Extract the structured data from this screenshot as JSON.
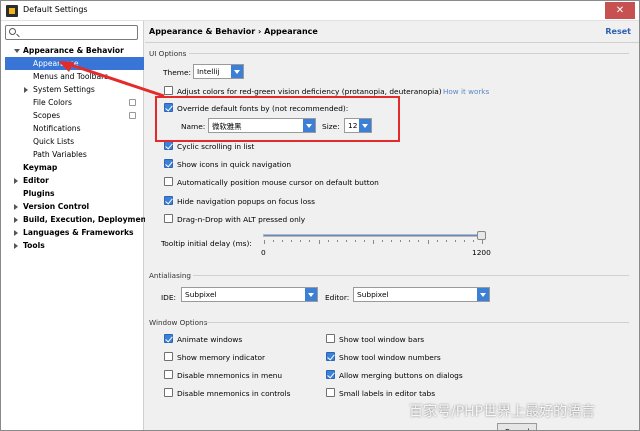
{
  "window": {
    "title": "Default Settings",
    "close_glyph": "✕"
  },
  "sidebar": {
    "search": {
      "placeholder": "",
      "value": ""
    },
    "items": [
      {
        "label": "Appearance & Behavior",
        "icon": "chevron-down-icon"
      },
      {
        "label": "Appearance"
      },
      {
        "label": "Menus and Toolbars"
      },
      {
        "label": "System Settings",
        "icon": "chevron-right-icon"
      },
      {
        "label": "File Colors"
      },
      {
        "label": "Scopes"
      },
      {
        "label": "Notifications"
      },
      {
        "label": "Quick Lists"
      },
      {
        "label": "Path Variables"
      },
      {
        "label": "Keymap"
      },
      {
        "label": "Editor",
        "icon": "chevron-right-icon"
      },
      {
        "label": "Plugins"
      },
      {
        "label": "Version Control",
        "icon": "chevron-right-icon"
      },
      {
        "label": "Build, Execution, Deployment",
        "icon": "chevron-right-icon"
      },
      {
        "label": "Languages & Frameworks",
        "icon": "chevron-right-icon"
      },
      {
        "label": "Tools",
        "icon": "chevron-right-icon"
      }
    ]
  },
  "header": {
    "breadcrumb_parent": "Appearance & Behavior",
    "separator": "›",
    "breadcrumb_current": "Appearance",
    "reset": "Reset"
  },
  "ui_options": {
    "section_title": "UI Options",
    "theme_label": "Theme:",
    "theme_value": "Intellij",
    "adjust_colors": {
      "label": "Adjust colors for red-green vision deficiency (protanopia, deuteranopia)",
      "checked": false,
      "link": "How it works"
    },
    "override_fonts": {
      "label": "Override default fonts by (not recommended):",
      "checked": true
    },
    "name_label": "Name:",
    "name_value": "微软雅黑",
    "size_label": "Size:",
    "size_value": "12",
    "checkboxes": [
      {
        "label": "Cyclic scrolling in list",
        "checked": true
      },
      {
        "label": "Show icons in quick navigation",
        "checked": true
      },
      {
        "label": "Automatically position mouse cursor on default button",
        "checked": false
      },
      {
        "label": "Hide navigation popups on focus loss",
        "checked": true
      },
      {
        "label": "Drag-n-Drop with ALT pressed only",
        "checked": false
      }
    ],
    "tooltip_label": "Tooltip initial delay (ms):",
    "tooltip_min": "0",
    "tooltip_max": "1200",
    "tooltip_value_fraction": 1.0
  },
  "antialiasing": {
    "section_title": "Antialiasing",
    "ide_label": "IDE:",
    "ide_value": "Subpixel",
    "editor_label": "Editor:",
    "editor_value": "Subpixel"
  },
  "window_options": {
    "section_title": "Window Options",
    "left": [
      {
        "label": "Animate windows",
        "checked": true
      },
      {
        "label": "Show memory indicator",
        "checked": false
      },
      {
        "label": "Disable mnemonics in menu",
        "checked": false
      },
      {
        "label": "Disable mnemonics in controls",
        "checked": false
      }
    ],
    "right": [
      {
        "label": "Show tool window bars",
        "checked": false
      },
      {
        "label": "Show tool window numbers",
        "checked": true
      },
      {
        "label": "Allow merging buttons on dialogs",
        "checked": true
      },
      {
        "label": "Small labels in editor tabs",
        "checked": false
      }
    ]
  },
  "footer": {
    "cancel": "Cancel"
  },
  "watermark": "百家号/PHP世界上最好的语言",
  "colors": {
    "accent": "#3875d7",
    "highlight": "#e32b2b"
  }
}
